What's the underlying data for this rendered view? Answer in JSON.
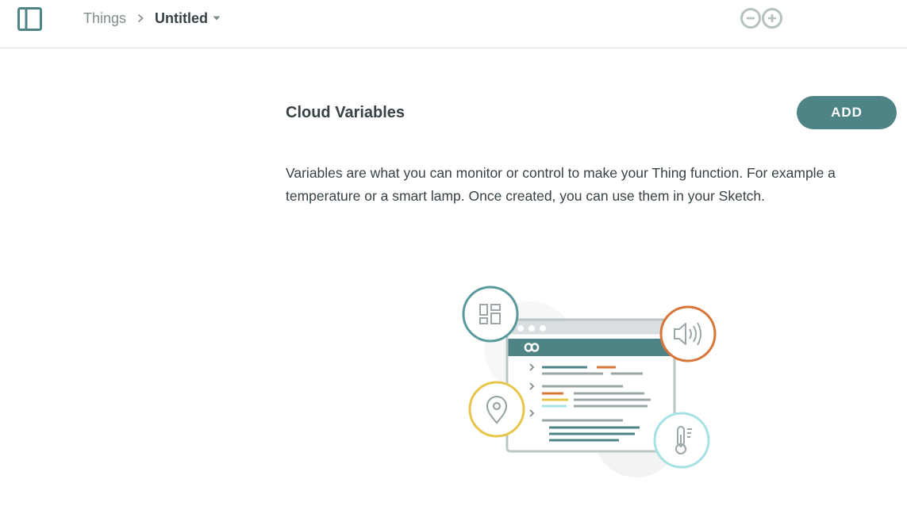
{
  "header": {
    "breadcrumb_parent": "Things",
    "breadcrumb_current": "Untitled"
  },
  "icons": {
    "sidebar_toggle": "sidebar-panel-icon",
    "breadcrumb_separator": "chevron-right-icon",
    "title_dropdown": "caret-down-icon",
    "logo": "arduino-logo",
    "illustration_widgets": "dashboard-widgets-icon",
    "illustration_speaker": "speaker-icon",
    "illustration_location": "location-pin-icon",
    "illustration_temperature": "thermometer-icon"
  },
  "main": {
    "section_title": "Cloud Variables",
    "add_button_label": "ADD",
    "description": "Variables are what you can monitor or control to make your Thing function. For example a temperature or a smart lamp. Once created, you can use them in your Sketch."
  },
  "colors": {
    "accent": "#4e8485",
    "teal_light": "#5a9a9c",
    "orange": "#d8763a",
    "yellow": "#e6c64a",
    "light_cyan": "#a6e1e3",
    "text_dark": "#374146",
    "text_muted": "#7f8c8d",
    "border": "#dae3e3"
  }
}
